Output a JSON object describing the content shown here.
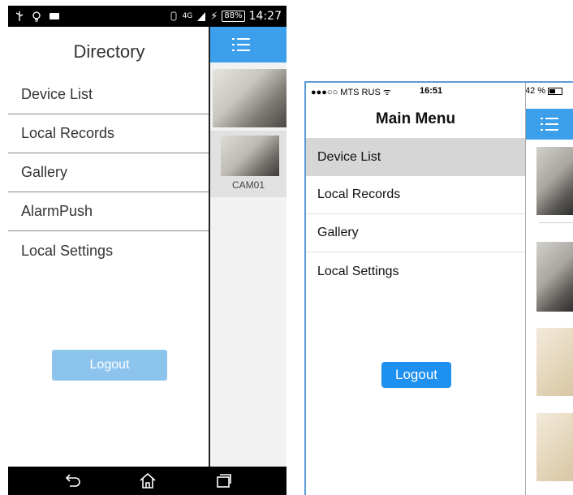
{
  "android": {
    "status": {
      "network": "4G",
      "battery": "88%",
      "time": "14:27"
    },
    "drawer_title": "Directory",
    "menu": [
      "Device List",
      "Local Records",
      "Gallery",
      "AlarmPush",
      "Local Settings"
    ],
    "logout_label": "Logout",
    "camera_label": "CAM01"
  },
  "ios": {
    "status": {
      "carrier": "●●●○○ MTS RUS ᯤ",
      "time": "16:51",
      "battery": "42 %"
    },
    "drawer_title": "Main Menu",
    "menu": [
      "Device List",
      "Local Records",
      "Gallery",
      "Local Settings"
    ],
    "active_item": "Device List",
    "logout_label": "Logout"
  },
  "colors": {
    "accent_blue": "#3c9fec",
    "android_logout_bg": "#8dc4ee",
    "ios_logout_bg": "#1e90ef",
    "ios_active_bg": "#d6d6d6"
  }
}
